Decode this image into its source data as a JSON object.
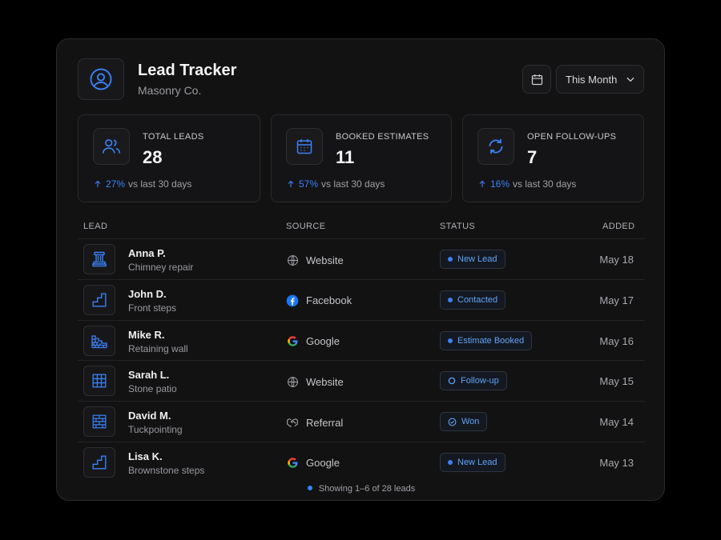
{
  "header": {
    "title": "Lead Tracker",
    "subtitle": "Masonry Co.",
    "avatar_icon": "user-circle-icon",
    "calendar_icon": "calendar-icon",
    "range_label": "This Month",
    "range_icon": "chevron-down-icon"
  },
  "stats": [
    {
      "icon": "users-icon",
      "label": "TOTAL LEADS",
      "value": "28",
      "delta_pct": "27%",
      "delta_text": "vs last 30 days"
    },
    {
      "icon": "calendar-icon",
      "label": "BOOKED ESTIMATES",
      "value": "11",
      "delta_pct": "57%",
      "delta_text": "vs last 30 days"
    },
    {
      "icon": "refresh-icon",
      "label": "OPEN FOLLOW-UPS",
      "value": "7",
      "delta_pct": "16%",
      "delta_text": "vs last 30 days"
    }
  ],
  "table": {
    "columns": [
      "LEAD",
      "SOURCE",
      "STATUS",
      "ADDED"
    ],
    "rows": [
      {
        "icon": "chimney-icon",
        "name": "Anna P.",
        "project": "Chimney repair",
        "source": "Website",
        "source_icon": "globe-icon",
        "status": "New Lead",
        "status_icon": "dot",
        "added": "May 18"
      },
      {
        "icon": "steps-icon",
        "name": "John D.",
        "project": "Front steps",
        "source": "Facebook",
        "source_icon": "facebook-icon",
        "status": "Contacted",
        "status_icon": "dot",
        "added": "May 17"
      },
      {
        "icon": "retaining-wall-icon",
        "name": "Mike R.",
        "project": "Retaining wall",
        "source": "Google",
        "source_icon": "google-icon",
        "status": "Estimate Booked",
        "status_icon": "dot",
        "added": "May 16"
      },
      {
        "icon": "patio-grid-icon",
        "name": "Sarah L.",
        "project": "Stone patio",
        "source": "Website",
        "source_icon": "globe-icon",
        "status": "Follow-up",
        "status_icon": "ring",
        "added": "May 15"
      },
      {
        "icon": "brick-wall-icon",
        "name": "David M.",
        "project": "Tuckpointing",
        "source": "Referral",
        "source_icon": "handshake-icon",
        "status": "Won",
        "status_icon": "check-circle",
        "added": "May 14"
      },
      {
        "icon": "steps-icon",
        "name": "Lisa K.",
        "project": "Brownstone steps",
        "source": "Google",
        "source_icon": "google-icon",
        "status": "New Lead",
        "status_icon": "dot",
        "added": "May 13"
      }
    ]
  },
  "footer": {
    "text": "Showing 1–6 of 28 leads"
  },
  "colors": {
    "accent": "#3b82f6",
    "background": "#000000",
    "card": "#121213",
    "border": "#2a2a2d"
  }
}
